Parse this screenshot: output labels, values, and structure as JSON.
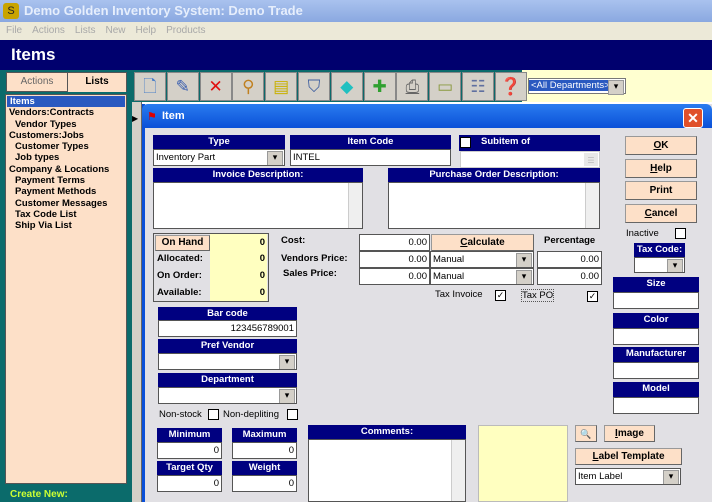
{
  "app": {
    "title": "Demo Golden Inventory System: Demo Trade",
    "menu": [
      "File",
      "Actions",
      "Lists",
      "New",
      "Help",
      "Products"
    ],
    "page_title": "Items"
  },
  "sidebar": {
    "tabs": [
      "Actions",
      "Lists"
    ],
    "active_tab": "Lists",
    "items": [
      {
        "label": "Items",
        "selected": true,
        "sub": false
      },
      {
        "label": "Vendors:Contracts",
        "sub": false
      },
      {
        "label": "Vendor Types",
        "sub": true
      },
      {
        "label": "Customers:Jobs",
        "sub": false
      },
      {
        "label": "Customer Types",
        "sub": true
      },
      {
        "label": "Job types",
        "sub": true
      },
      {
        "label": "Company & Locations",
        "sub": false
      },
      {
        "label": "Payment Terms",
        "sub": true
      },
      {
        "label": "Payment Methods",
        "sub": true
      },
      {
        "label": "Customer Messages",
        "sub": true
      },
      {
        "label": "Tax Code List",
        "sub": true
      },
      {
        "label": "Ship Via List",
        "sub": true
      }
    ],
    "create_new": "Create New:"
  },
  "toolbar": {
    "buttons": [
      "new-document-icon",
      "edit-icon",
      "delete-icon",
      "search-icon",
      "typewriter-icon",
      "filter-icon",
      "diamond-icon",
      "add-icon",
      "print-icon",
      "register-icon",
      "list-icon",
      "help-book-icon"
    ],
    "department": "<All Departments>"
  },
  "dialog": {
    "title": "Item",
    "type": {
      "label": "Type",
      "value": "Inventory Part"
    },
    "item_code": {
      "label": "Item Code",
      "value": "INTEL"
    },
    "subitem": {
      "label": "Subitem of",
      "value": ""
    },
    "invoice_desc": {
      "label": "Invoice Description:",
      "value": ""
    },
    "po_desc": {
      "label": "Purchase Order Description:",
      "value": ""
    },
    "stock": {
      "on_hand_label": "On Hand",
      "on_hand": "0",
      "allocated_label": "Allocated:",
      "allocated": "0",
      "on_order_label": "On Order:",
      "on_order": "0",
      "available_label": "Available:",
      "available": "0"
    },
    "pricing": {
      "cost_label": "Cost:",
      "cost": "0.00",
      "vendors_label": "Vendors Price:",
      "vendors": "0.00",
      "sales_label": "Sales Price:",
      "sales": "0.00",
      "calculate": "Calculate",
      "percentage_label": "Percentage",
      "vendors_method": "Manual",
      "sales_method": "Manual",
      "vendors_pct": "0.00",
      "sales_pct": "0.00"
    },
    "tax_invoice": {
      "label": "Tax Invoice",
      "checked": true
    },
    "tax_po": {
      "label": "Tax PO",
      "checked": true
    },
    "barcode": {
      "label": "Bar code",
      "value": "123456789001"
    },
    "pref_vendor": {
      "label": "Pref Vendor",
      "value": ""
    },
    "department": {
      "label": "Department",
      "value": ""
    },
    "non_stock": {
      "label": "Non-stock",
      "checked": false
    },
    "non_depleting": {
      "label": "Non-depliting",
      "checked": false
    },
    "minimum": {
      "label": "Minimum",
      "value": "0"
    },
    "maximum": {
      "label": "Maximum",
      "value": "0"
    },
    "target_qty": {
      "label": "Target Qty",
      "value": "0"
    },
    "weight": {
      "label": "Weight",
      "value": "0"
    },
    "comments": {
      "label": "Comments:",
      "value": ""
    },
    "image_button": "Image",
    "label_template_button": "Label Template",
    "label_template": "Item Label",
    "ok": "OK",
    "help": "Help",
    "print": "Print",
    "cancel": "Cancel",
    "inactive": {
      "label": "Inactive",
      "checked": false
    },
    "tax_code": {
      "label": "Tax Code:",
      "value": ""
    },
    "size": {
      "label": "Size",
      "value": ""
    },
    "color": {
      "label": "Color",
      "value": ""
    },
    "manufacturer": {
      "label": "Manufacturer",
      "value": ""
    },
    "model": {
      "label": "Model",
      "value": ""
    }
  }
}
